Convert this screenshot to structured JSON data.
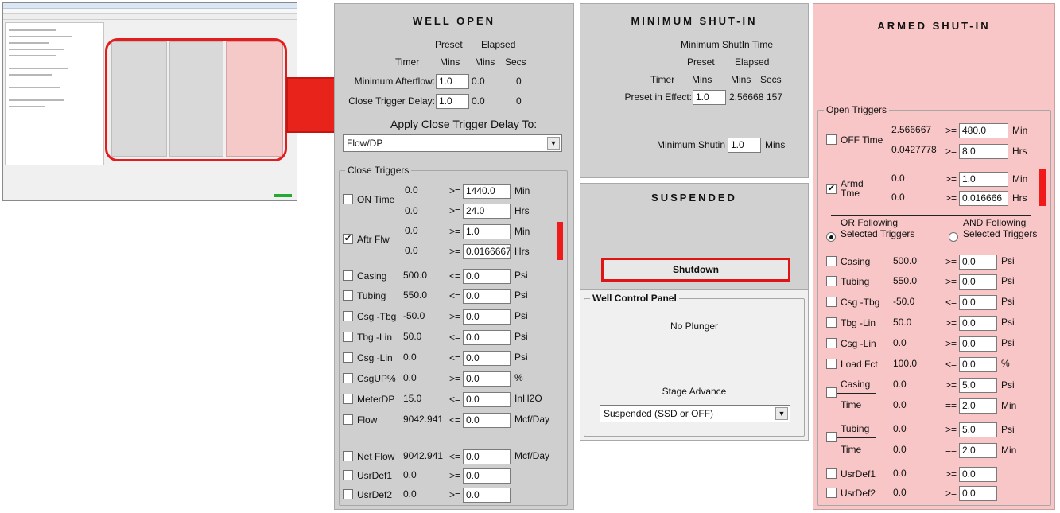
{
  "thumbnail": {
    "alt": "screenshot thumbnail"
  },
  "well_open": {
    "title": "WELL OPEN",
    "hdr": {
      "preset": "Preset",
      "elapsed": "Elapsed",
      "timer": "Timer",
      "mins1": "Mins",
      "mins2": "Mins",
      "secs": "Secs"
    },
    "min_afterflow": {
      "label": "Minimum Afterflow:",
      "value": "1.0",
      "elapsed_mins": "0.0",
      "secs": "0"
    },
    "close_trigger_delay": {
      "label": "Close Trigger Delay:",
      "value": "1.0",
      "elapsed_mins": "0.0",
      "secs": "0"
    },
    "apply_label": "Apply Close Trigger Delay To:",
    "apply_select": "Flow/DP",
    "close_triggers": {
      "title": "Close Triggers",
      "on_time": {
        "label": "ON Time",
        "v1": "0.0",
        "op1": ">=",
        "f1": "1440.0",
        "u1": "Min",
        "v2": "0.0",
        "op2": ">=",
        "f2": "24.0",
        "u2": "Hrs"
      },
      "aftr_flw": {
        "label": "Aftr Flw",
        "check": "✔",
        "v1": "0.0",
        "op1": ">=",
        "f1": "1.0",
        "u1": "Min",
        "v2": "0.0",
        "op2": ">=",
        "f2": "0.0166667",
        "u2": "Hrs"
      },
      "rows": [
        {
          "label": "Casing",
          "val": "500.0",
          "op": "<=",
          "field": "0.0",
          "unit": "Psi"
        },
        {
          "label": "Tubing",
          "val": "550.0",
          "op": "<=",
          "field": "0.0",
          "unit": "Psi"
        },
        {
          "label": "Csg -Tbg",
          "val": "-50.0",
          "op": ">=",
          "field": "0.0",
          "unit": "Psi"
        },
        {
          "label": "Tbg -Lin",
          "val": "50.0",
          "op": "<=",
          "field": "0.0",
          "unit": "Psi"
        },
        {
          "label": "Csg -Lin",
          "val": "0.0",
          "op": "<=",
          "field": "0.0",
          "unit": "Psi"
        },
        {
          "label": "CsgUP%",
          "val": "0.0",
          "op": ">=",
          "field": "0.0",
          "unit": "%"
        },
        {
          "label": "MeterDP",
          "val": "15.0",
          "op": "<=",
          "field": "0.0",
          "unit": "InH2O"
        },
        {
          "label": "Flow",
          "val": "9042.941",
          "op": "<=",
          "field": "0.0",
          "unit": "Mcf/Day"
        },
        {
          "label": "Net Flow",
          "val": "9042.941",
          "op": "<=",
          "field": "0.0",
          "unit": "Mcf/Day"
        },
        {
          "label": "UsrDef1",
          "val": "0.0",
          "op": ">=",
          "field": "0.0",
          "unit": ""
        },
        {
          "label": "UsrDef2",
          "val": "0.0",
          "op": ">=",
          "field": "0.0",
          "unit": ""
        }
      ]
    }
  },
  "min_shutin": {
    "title": "MINIMUM SHUT-IN",
    "subtitle": "Minimum ShutIn Time",
    "hdr": {
      "preset": "Preset",
      "elapsed": "Elapsed",
      "timer": "Timer",
      "mins1": "Mins",
      "mins2": "Mins",
      "secs": "Secs"
    },
    "preset_in_effect": {
      "label": "Preset in Effect:",
      "value": "1.0",
      "elapsed": "2.56668",
      "secs": "157"
    },
    "min_shutin": {
      "label": "Minimum Shutin",
      "value": "1.0",
      "unit": "Mins"
    }
  },
  "suspended": {
    "title": "SUSPENDED",
    "button": "Shutdown"
  },
  "well_control": {
    "title": "Well Control Panel",
    "status": "No Plunger",
    "stage_label": "Stage Advance",
    "stage_select": "Suspended (SSD or OFF)"
  },
  "armed": {
    "title": "ARMED SHUT-IN",
    "open_triggers": {
      "title": "Open Triggers",
      "off_time": {
        "label": "OFF Time",
        "v1": "2.566667",
        "op1": ">=",
        "f1": "480.0",
        "u1": "Min",
        "v2": "0.0427778",
        "op2": ">=",
        "f2": "8.0",
        "u2": "Hrs"
      },
      "armd_time": {
        "label": "Armd Tme",
        "check": "✔",
        "v1": "0.0",
        "op1": ">=",
        "f1": "1.0",
        "u1": "Min",
        "v2": "0.0",
        "op2": ">=",
        "f2": "0.016666",
        "u2": "Hrs"
      },
      "or_following": "OR Following Selected Triggers",
      "and_following": "AND Following Selected Triggers",
      "rows": [
        {
          "label": "Casing",
          "val": "500.0",
          "op": ">=",
          "field": "0.0",
          "unit": "Psi"
        },
        {
          "label": "Tubing",
          "val": "550.0",
          "op": ">=",
          "field": "0.0",
          "unit": "Psi"
        },
        {
          "label": "Csg -Tbg",
          "val": "-50.0",
          "op": "<=",
          "field": "0.0",
          "unit": "Psi"
        },
        {
          "label": "Tbg -Lin",
          "val": "50.0",
          "op": ">=",
          "field": "0.0",
          "unit": "Psi"
        },
        {
          "label": "Csg -Lin",
          "val": "0.0",
          "op": ">=",
          "field": "0.0",
          "unit": "Psi"
        },
        {
          "label": "Load Fct",
          "val": "100.0",
          "op": "<=",
          "field": "0.0",
          "unit": "%"
        }
      ],
      "casing_time": {
        "l1": "Casing",
        "v1": "0.0",
        "op1": ">=",
        "f1": "5.0",
        "u1": "Psi",
        "l2": "Time",
        "v2": "0.0",
        "op2": "==",
        "f2": "2.0",
        "u2": "Min"
      },
      "tubing_time": {
        "l1": "Tubing",
        "v1": "0.0",
        "op1": ">=",
        "f1": "5.0",
        "u1": "Psi",
        "l2": "Time",
        "v2": "0.0",
        "op2": "==",
        "f2": "2.0",
        "u2": "Min"
      },
      "usr": [
        {
          "label": "UsrDef1",
          "val": "0.0",
          "op": ">=",
          "field": "0.0"
        },
        {
          "label": "UsrDef2",
          "val": "0.0",
          "op": ">=",
          "field": "0.0"
        }
      ]
    }
  },
  "colors": {
    "highlight": "#e41c1c",
    "armed_bg": "#f8c6c6",
    "panel_bg": "#cfcfcf"
  }
}
